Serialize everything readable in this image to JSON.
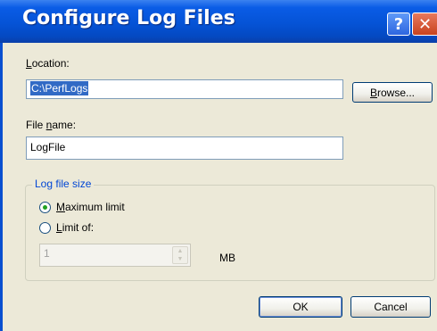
{
  "dialog": {
    "title": "Configure Log Files",
    "help_glyph": "?",
    "close_glyph": "✕"
  },
  "location": {
    "label_pre": "",
    "label_key": "L",
    "label_post": "ocation:",
    "value": "C:\\PerfLogs",
    "browse_pre": "",
    "browse_key": "B",
    "browse_post": "rowse..."
  },
  "file_name": {
    "label_pre": "File ",
    "label_key": "n",
    "label_post": "ame:",
    "value": "LogFile"
  },
  "log_size": {
    "group_title": "Log file size",
    "max_pre": "",
    "max_key": "M",
    "max_post": "aximum limit",
    "max_selected": true,
    "limit_pre": "",
    "limit_key": "L",
    "limit_post": "imit of:",
    "limit_selected": false,
    "limit_value": "1",
    "unit": "MB"
  },
  "buttons": {
    "ok": "OK",
    "cancel": "Cancel"
  },
  "icons": {
    "help": "help-icon",
    "close": "close-icon",
    "spin_up": "arrow-up-icon",
    "spin_down": "arrow-down-icon"
  }
}
